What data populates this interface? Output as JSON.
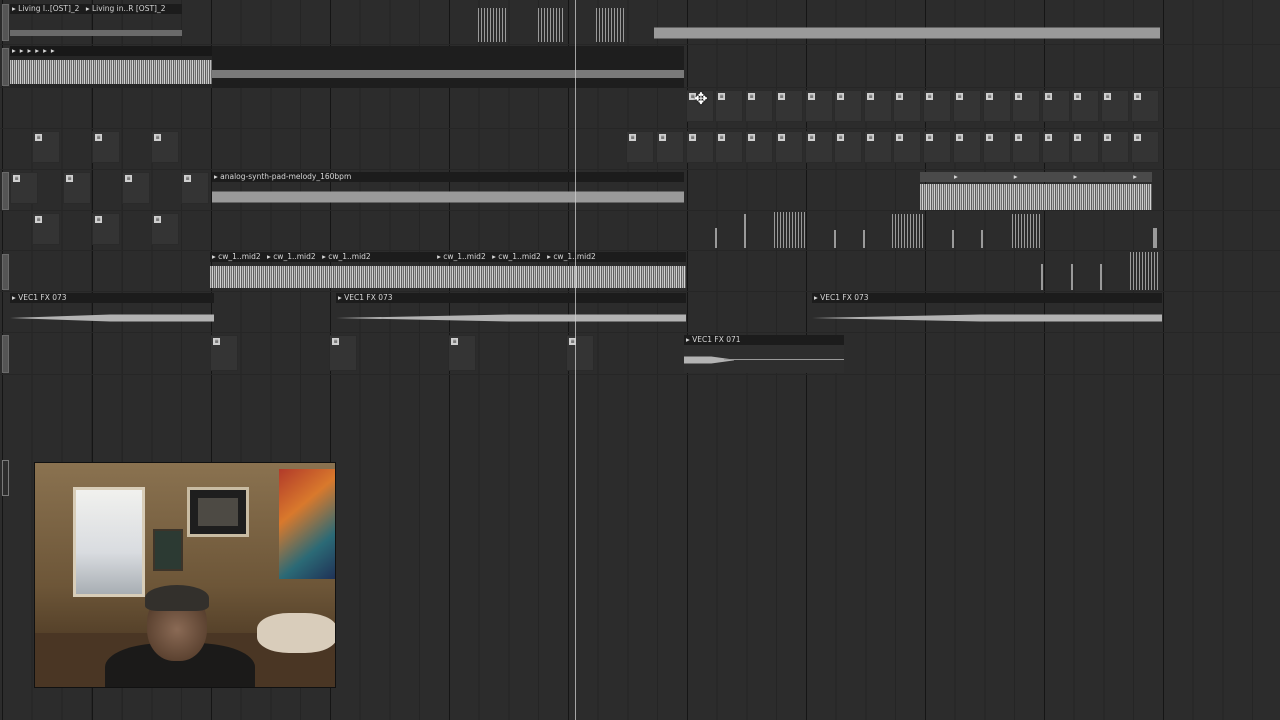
{
  "clips": {
    "living_1": "Living I..[OST]_2",
    "living_2": "Living in..R [OST]_2",
    "analog_synth": "analog-synth-pad-melody_160bpm",
    "cw_mid": "cw_1..mid2",
    "vec1_fx073": "VEC1 FX 073",
    "vec1_fx071": "VEC1 FX 071"
  }
}
